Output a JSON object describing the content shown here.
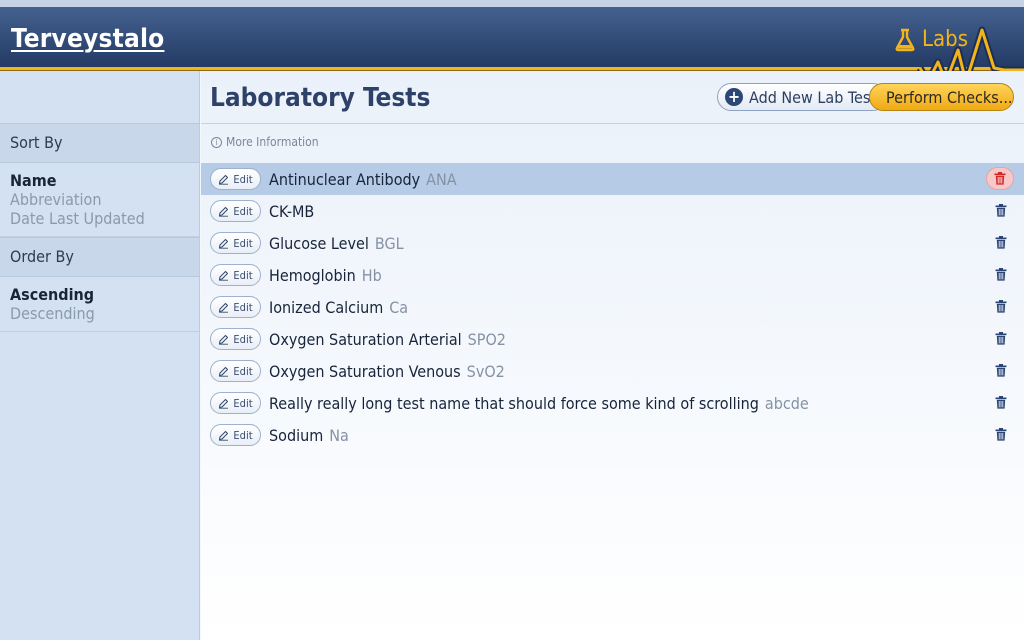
{
  "header": {
    "brand": "Terveystalo",
    "section": "Labs",
    "colors": {
      "accent": "#f2b419",
      "header_bg": "#2f4a78"
    }
  },
  "sidebar": {
    "sort_header": "Sort By",
    "sort_options": [
      {
        "label": "Name",
        "active": true
      },
      {
        "label": "Abbreviation",
        "active": false
      },
      {
        "label": "Date Last Updated",
        "active": false
      }
    ],
    "order_header": "Order By",
    "order_options": [
      {
        "label": "Ascending",
        "active": true
      },
      {
        "label": "Descending",
        "active": false
      }
    ]
  },
  "main": {
    "title": "Laboratory Tests",
    "add_button": "Add New Lab Test",
    "check_button": "Perform Checks...",
    "more_info": "More Information",
    "edit_label": "Edit",
    "tests": [
      {
        "name": "Antinuclear Antibody",
        "abbr": "ANA",
        "selected": true
      },
      {
        "name": "CK-MB",
        "abbr": ""
      },
      {
        "name": "Glucose Level",
        "abbr": "BGL"
      },
      {
        "name": "Hemoglobin",
        "abbr": "Hb"
      },
      {
        "name": "Ionized Calcium",
        "abbr": "Ca"
      },
      {
        "name": "Oxygen Saturation Arterial",
        "abbr": "SPO2"
      },
      {
        "name": "Oxygen Saturation Venous",
        "abbr": "SvO2"
      },
      {
        "name": "Really really long test name that should force some kind of scrolling",
        "abbr": "abcde"
      },
      {
        "name": "Sodium",
        "abbr": "Na"
      }
    ],
    "icons": {
      "add": "plus-circle-icon",
      "check": "flask-icon",
      "edit": "pencil-icon",
      "delete": "trash-icon",
      "info": "info-icon"
    }
  }
}
